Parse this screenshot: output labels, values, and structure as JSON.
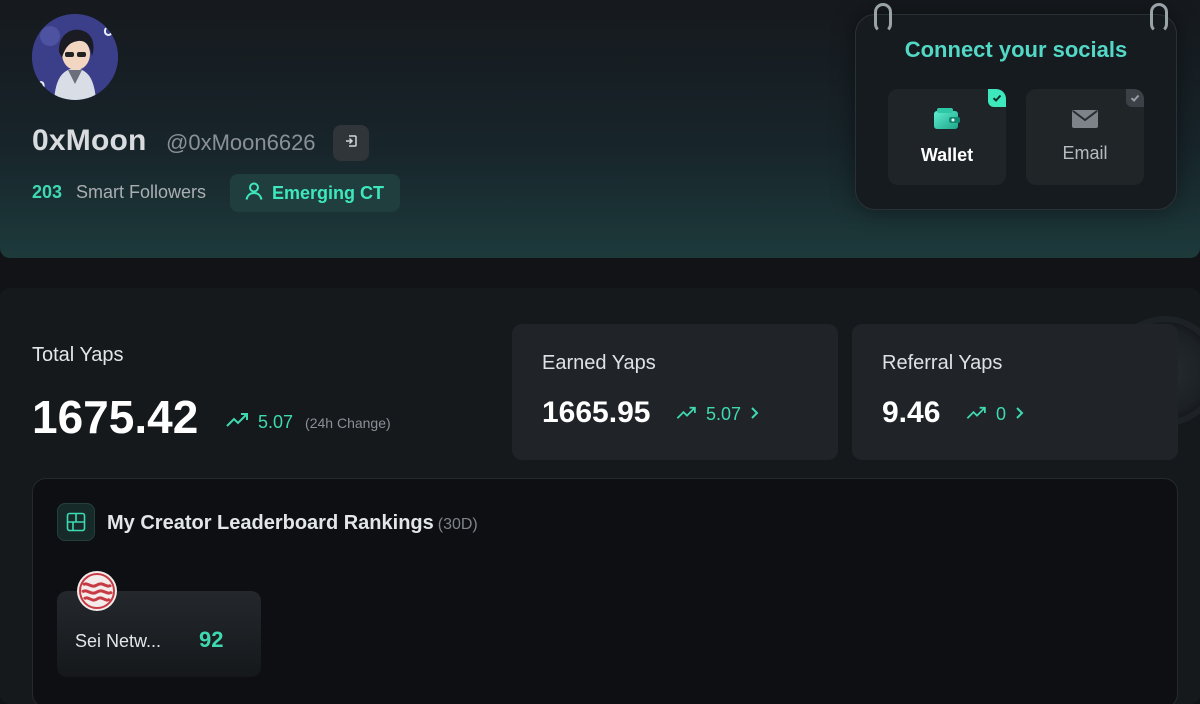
{
  "profile": {
    "name": "0xMoon",
    "handle": "@0xMoon6626",
    "smart_followers_count": "203",
    "smart_followers_label": "Smart Followers",
    "badge_label": "Emerging CT"
  },
  "connect": {
    "title": "Connect your socials",
    "wallet_label": "Wallet",
    "email_label": "Email"
  },
  "stats": {
    "total": {
      "label": "Total Yaps",
      "value": "1675.42",
      "change": "5.07",
      "period": "(24h Change)"
    },
    "earned": {
      "label": "Earned Yaps",
      "value": "1665.95",
      "change": "5.07"
    },
    "referral": {
      "label": "Referral Yaps",
      "value": "9.46",
      "change": "0"
    }
  },
  "rankings": {
    "title": "My Creator Leaderboard Rankings",
    "period": "(30D)",
    "items": [
      {
        "name": "Sei Netw...",
        "score": "92"
      }
    ]
  },
  "colors": {
    "accent": "#3ed9b0",
    "background": "#111316",
    "card": "#202428"
  }
}
